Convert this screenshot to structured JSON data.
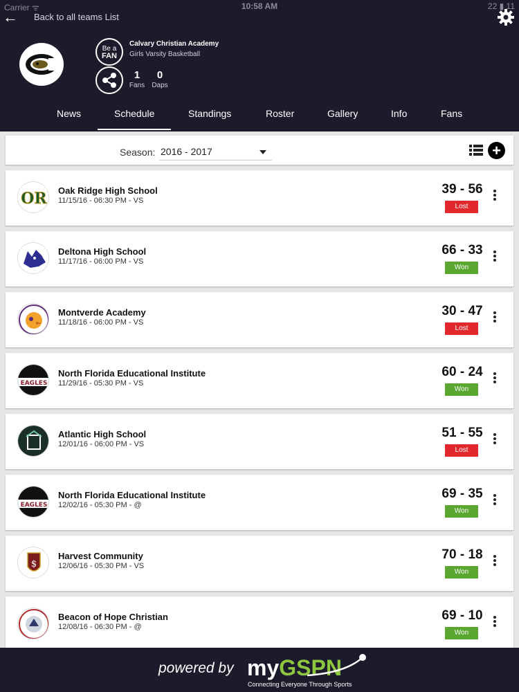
{
  "status_bar": {
    "carrier": "Carrier ᯤ",
    "time": "10:58 AM",
    "battery": "22 ▮ 11"
  },
  "header": {
    "back_label": "Back to all teams List",
    "team_name": "Calvary Christian Academy",
    "team_sub": "Girls Varsity Basketball",
    "fan_button": {
      "line1": "Be a",
      "line2": "FAN"
    },
    "stats": {
      "fans_count": "1",
      "fans_label": "Fans",
      "daps_count": "0",
      "daps_label": "Daps"
    }
  },
  "tabs": [
    {
      "label": "News"
    },
    {
      "label": "Schedule",
      "active": true
    },
    {
      "label": "Standings"
    },
    {
      "label": "Roster"
    },
    {
      "label": "Gallery"
    },
    {
      "label": "Info"
    },
    {
      "label": "Fans"
    }
  ],
  "season": {
    "label": "Season:",
    "value": "2016 - 2017"
  },
  "colors": {
    "header_bg": "#1c1b2c",
    "won": "#5aa72f",
    "lost": "#e2272d",
    "accent_green": "#8dc63f"
  },
  "games": [
    {
      "opponent": "Oak Ridge High School",
      "info": "11/15/16 - 06:30 PM - VS",
      "score": "39 - 56",
      "result": "Lost",
      "logo": "oak-ridge-logo"
    },
    {
      "opponent": "Deltona High School",
      "info": "11/17/16 - 06:00 PM - VS",
      "score": "66 - 33",
      "result": "Won",
      "logo": "deltona-wolf-logo"
    },
    {
      "opponent": "Montverde Academy",
      "info": "11/18/16 - 06:00 PM - VS",
      "score": "30 - 47",
      "result": "Lost",
      "logo": "montverde-eagle-logo"
    },
    {
      "opponent": "North Florida Educational Institute",
      "info": "11/29/16 - 05:30 PM - VS",
      "score": "60 - 24",
      "result": "Won",
      "logo": "eagles-logo"
    },
    {
      "opponent": "Atlantic High School",
      "info": "12/01/16 - 06:00 PM - VS",
      "score": "51 - 55",
      "result": "Lost",
      "logo": "atlantic-logo"
    },
    {
      "opponent": "North Florida Educational Institute",
      "info": "12/02/16 - 05:30 PM - @",
      "score": "69 - 35",
      "result": "Won",
      "logo": "eagles-logo"
    },
    {
      "opponent": "Harvest Community",
      "info": "12/06/16 - 05:30 PM - VS",
      "score": "70 - 18",
      "result": "Won",
      "logo": "harvest-shield-logo"
    },
    {
      "opponent": "Beacon of Hope Christian",
      "info": "12/08/16 - 06:30 PM - @",
      "score": "69 - 10",
      "result": "Won",
      "logo": "beacon-of-hope-logo"
    }
  ],
  "footer": {
    "powered_by": "powered by",
    "brand_prefix": "my",
    "brand_suffix": "GSPN",
    "tagline": "Connecting Everyone Through Sports"
  }
}
